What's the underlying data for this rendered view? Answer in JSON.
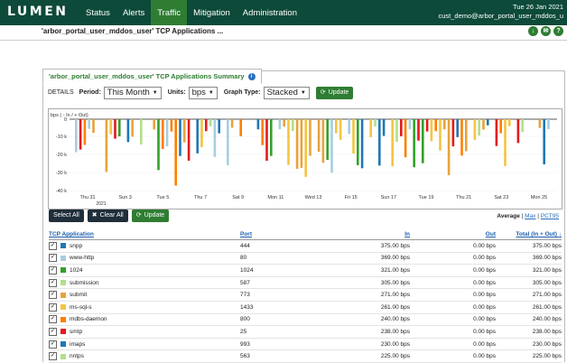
{
  "header": {
    "logo": "LUMEN",
    "nav": [
      {
        "label": "Status",
        "active": false
      },
      {
        "label": "Alerts",
        "active": false
      },
      {
        "label": "Traffic",
        "active": true
      },
      {
        "label": "Mitigation",
        "active": false
      },
      {
        "label": "Administration",
        "active": false
      }
    ],
    "date": "Tue 26 Jan 2021",
    "user": "cust_demo@arbor_portal_user_mddos_u"
  },
  "page_title": "'arbor_portal_user_mddos_user' TCP Applications ...",
  "panel": {
    "tab_title": "'arbor_portal_user_mddos_user' TCP Applications Summary",
    "details_label": "DETAILS",
    "period_label": "Period:",
    "period_value": "This Month",
    "units_label": "Units:",
    "units_value": "bps",
    "graph_type_label": "Graph Type:",
    "graph_type_value": "Stacked",
    "update_label": "Update"
  },
  "chart_data": {
    "type": "bar",
    "ylabel": "bps ( - In / + Out)",
    "yticks": [
      "0",
      "-10 k",
      "-20 k",
      "-30 k",
      "-40 k"
    ],
    "ylim": [
      -42000,
      0
    ],
    "xticks": [
      "Thu 31",
      "Sun 3",
      "Tue 5",
      "Thu 7",
      "Sat 9",
      "Mon 11",
      "Wed 13",
      "Fri 15",
      "Sun 17",
      "Tue 19",
      "Thu 21",
      "Sat 23",
      "Mon 25"
    ],
    "year_label": "2021",
    "series_colors": [
      "#1f78b4",
      "#a6cee3",
      "#33a02c",
      "#e8a33d",
      "#f4c542",
      "#b2df8a",
      "#ff7f00",
      "#e31a1c"
    ]
  },
  "buttons": {
    "select_all": "Select All",
    "clear_all": "Clear All",
    "update": "Update"
  },
  "avg": {
    "average": "Average",
    "sep1": "|",
    "max": "Max",
    "sep2": "|",
    "pct95": "PCT95"
  },
  "table": {
    "headers": {
      "app": "TCP Application",
      "port": "Port",
      "in": "In",
      "out": "Out",
      "total": "Total (In + Out)"
    },
    "rows": [
      {
        "app": "snpp",
        "port": "444",
        "in": "375.00 bps",
        "out": "0.00 bps",
        "total": "375.00 bps",
        "color": "#1f78b4"
      },
      {
        "app": "www-http",
        "port": "80",
        "in": "369.00 bps",
        "out": "0.00 bps",
        "total": "369.00 bps",
        "color": "#a6cee3"
      },
      {
        "app": "1024",
        "port": "1024",
        "in": "321.00 bps",
        "out": "0.00 bps",
        "total": "321.00 bps",
        "color": "#33a02c"
      },
      {
        "app": "submission",
        "port": "587",
        "in": "305.00 bps",
        "out": "0.00 bps",
        "total": "305.00 bps",
        "color": "#b2df8a"
      },
      {
        "app": "submit",
        "port": "773",
        "in": "271.00 bps",
        "out": "0.00 bps",
        "total": "271.00 bps",
        "color": "#e8a33d"
      },
      {
        "app": "ms-sql-s",
        "port": "1433",
        "in": "261.00 bps",
        "out": "0.00 bps",
        "total": "261.00 bps",
        "color": "#f4c542"
      },
      {
        "app": "mdbs-daemon",
        "port": "800",
        "in": "240.00 bps",
        "out": "0.00 bps",
        "total": "240.00 bps",
        "color": "#ff7f00"
      },
      {
        "app": "smtp",
        "port": "25",
        "in": "238.00 bps",
        "out": "0.00 bps",
        "total": "238.00 bps",
        "color": "#e31a1c"
      },
      {
        "app": "imaps",
        "port": "993",
        "in": "230.00 bps",
        "out": "0.00 bps",
        "total": "230.00 bps",
        "color": "#1f78b4"
      },
      {
        "app": "nntps",
        "port": "563",
        "in": "225.00 bps",
        "out": "0.00 bps",
        "total": "225.00 bps",
        "color": "#b2df8a"
      }
    ]
  }
}
